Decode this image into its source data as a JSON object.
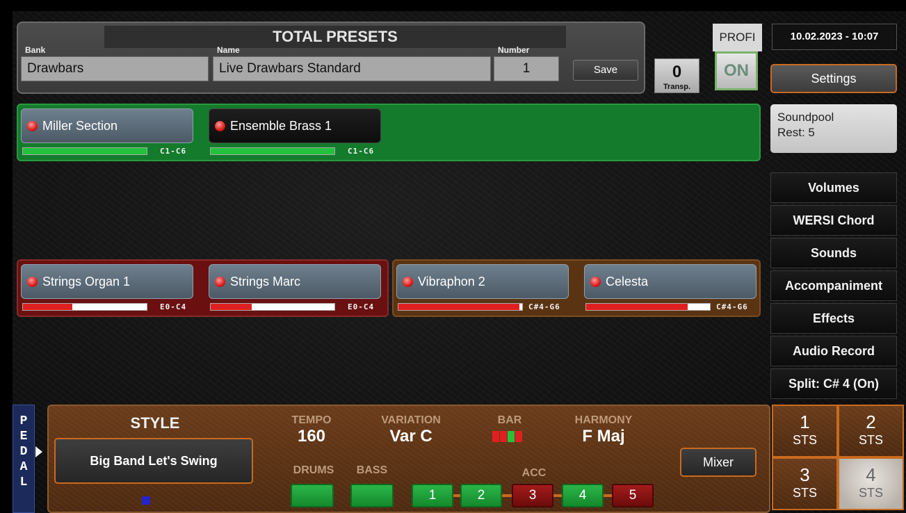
{
  "presets": {
    "title": "TOTAL PRESETS",
    "bank_label": "Bank",
    "bank_value": "Drawbars",
    "name_label": "Name",
    "name_value": "Live Drawbars Standard",
    "number_label": "Number",
    "number_value": "1",
    "save_label": "Save"
  },
  "transpose": {
    "value": "0",
    "label": "Transp."
  },
  "profi": {
    "label": "PROFI",
    "state": "ON"
  },
  "datetime": "10.02.2023 - 10:07",
  "settings_label": "Settings",
  "soundpool": {
    "line1": "Soundpool",
    "line2": "Rest: 5"
  },
  "menu": [
    "Volumes",
    "WERSI Chord",
    "Sounds",
    "Accompaniment",
    "Effects",
    "Audio Record",
    "Split: C# 4 (On)"
  ],
  "upper_layers": [
    {
      "name": "Miller Section",
      "range": "C1-C6",
      "fill": 1.0,
      "fill_color": "#22c23c"
    },
    {
      "name": "Ensemble Brass 1",
      "range": "C1-C6",
      "fill": 1.0,
      "fill_color": "#22c23c"
    }
  ],
  "lower_layers": [
    {
      "name": "Strings Organ 1",
      "range": "E0-C4",
      "fill": 0.4,
      "fill_color": "#e02020"
    },
    {
      "name": "Strings Marc",
      "range": "E0-C4",
      "fill": 0.33,
      "fill_color": "#e02020"
    },
    {
      "name": "Vibraphon 2",
      "range": "C#4-G6",
      "fill": 0.98,
      "fill_color": "#e02020"
    },
    {
      "name": "Celesta",
      "range": "C#4-G6",
      "fill": 0.82,
      "fill_color": "#e02020"
    }
  ],
  "style": {
    "pedal_label": [
      "P",
      "E",
      "D",
      "A",
      "L"
    ],
    "title": "STYLE",
    "name": "Big Band Let's Swing",
    "tempo_label": "TEMPO",
    "tempo_value": "160",
    "variation_label": "VARIATION",
    "variation_value": "Var C",
    "bar_label": "BAR",
    "harmony_label": "HARMONY",
    "harmony_value": "F Maj",
    "drums_label": "DRUMS",
    "bass_label": "BASS",
    "acc_label": "ACC",
    "acc_buttons": [
      {
        "label": "1",
        "state": "on"
      },
      {
        "label": "2",
        "state": "on"
      },
      {
        "label": "3",
        "state": "off"
      },
      {
        "label": "4",
        "state": "on"
      },
      {
        "label": "5",
        "state": "off"
      }
    ],
    "mixer_label": "Mixer"
  },
  "sts": [
    {
      "num": "1",
      "label": "STS",
      "active": false
    },
    {
      "num": "2",
      "label": "STS",
      "active": false
    },
    {
      "num": "3",
      "label": "STS",
      "active": false
    },
    {
      "num": "4",
      "label": "STS",
      "active": true
    }
  ]
}
